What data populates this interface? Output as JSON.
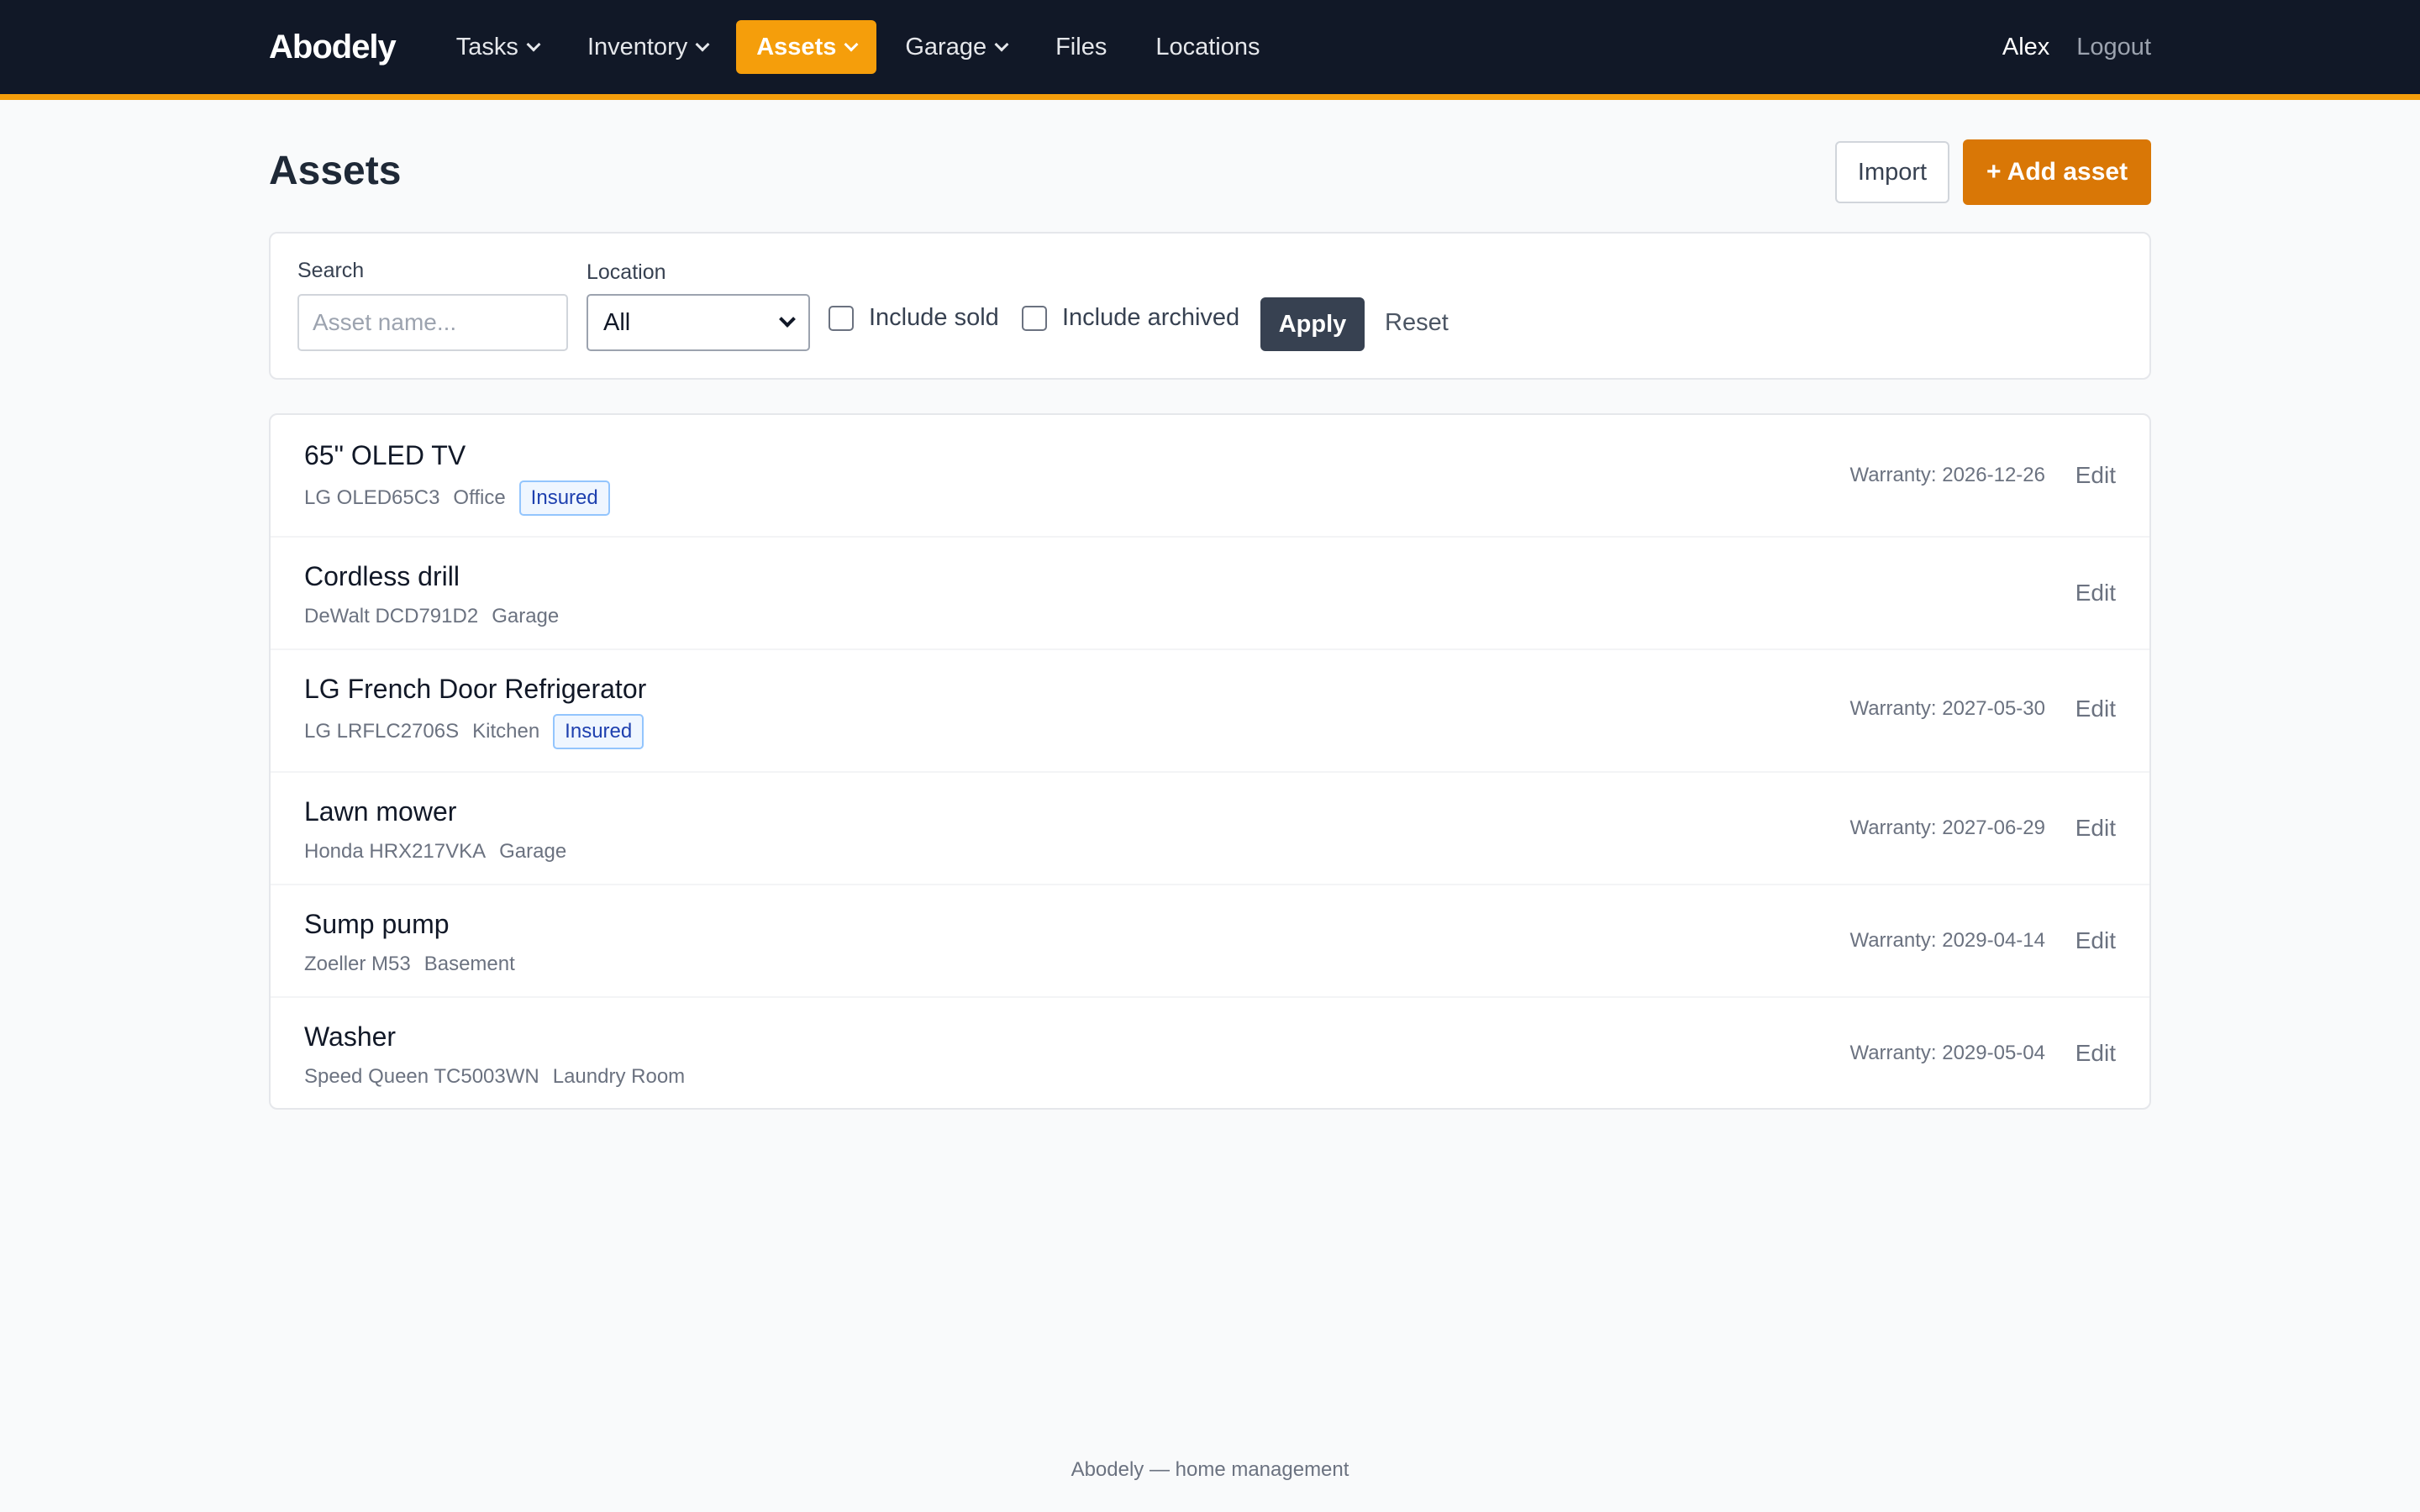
{
  "nav": {
    "brand": "Abodely",
    "items": [
      {
        "label": "Tasks",
        "dropdown": true,
        "active": false
      },
      {
        "label": "Inventory",
        "dropdown": true,
        "active": false
      },
      {
        "label": "Assets",
        "dropdown": true,
        "active": true
      },
      {
        "label": "Garage",
        "dropdown": true,
        "active": false
      },
      {
        "label": "Files",
        "dropdown": false,
        "active": false
      },
      {
        "label": "Locations",
        "dropdown": false,
        "active": false
      }
    ],
    "user": "Alex",
    "logout": "Logout"
  },
  "page": {
    "title": "Assets",
    "import_label": "Import",
    "add_label": "+ Add asset"
  },
  "filters": {
    "search_label": "Search",
    "search_placeholder": "Asset name...",
    "search_value": "",
    "location_label": "Location",
    "location_value": "All",
    "include_sold_label": "Include sold",
    "include_sold_checked": false,
    "include_archived_label": "Include archived",
    "include_archived_checked": false,
    "apply_label": "Apply",
    "reset_label": "Reset"
  },
  "assets": [
    {
      "name": "65\" OLED TV",
      "model": "LG OLED65C3",
      "location": "Office",
      "badge": "Insured",
      "warranty": "Warranty: 2026-12-26",
      "edit": "Edit"
    },
    {
      "name": "Cordless drill",
      "model": "DeWalt DCD791D2",
      "location": "Garage",
      "badge": "",
      "warranty": "",
      "edit": "Edit"
    },
    {
      "name": "LG French Door Refrigerator",
      "model": "LG LRFLC2706S",
      "location": "Kitchen",
      "badge": "Insured",
      "warranty": "Warranty: 2027-05-30",
      "edit": "Edit"
    },
    {
      "name": "Lawn mower",
      "model": "Honda HRX217VKA",
      "location": "Garage",
      "badge": "",
      "warranty": "Warranty: 2027-06-29",
      "edit": "Edit"
    },
    {
      "name": "Sump pump",
      "model": "Zoeller M53",
      "location": "Basement",
      "badge": "",
      "warranty": "Warranty: 2029-04-14",
      "edit": "Edit"
    },
    {
      "name": "Washer",
      "model": "Speed Queen TC5003WN",
      "location": "Laundry Room",
      "badge": "",
      "warranty": "Warranty: 2029-05-04",
      "edit": "Edit"
    }
  ],
  "footer": "Abodely — home management",
  "colors": {
    "nav_bg": "#111827",
    "accent": "#f59e0b",
    "add_button": "#d97706",
    "apply_button": "#374151",
    "badge_text": "#1e40af"
  }
}
